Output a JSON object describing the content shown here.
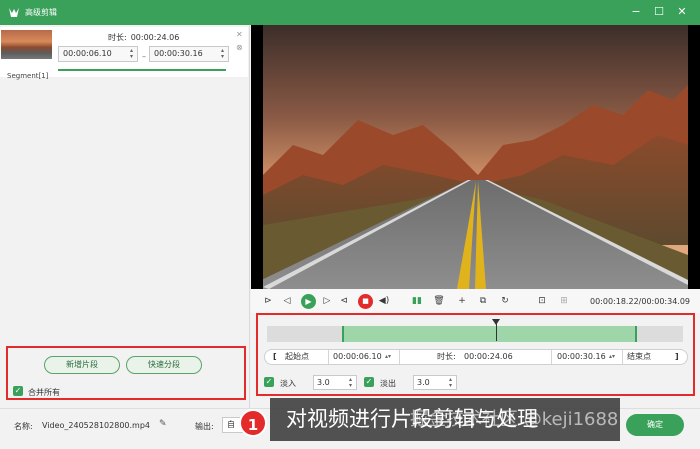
{
  "window": {
    "title": "高级剪辑",
    "controls": {
      "minimize": "−",
      "maximize": "☐",
      "close": "✕"
    }
  },
  "segments": [
    {
      "label": "Segment[1]",
      "duration_label": "时长:",
      "duration": "00:00:24.06",
      "start": "00:00:06.10",
      "end": "00:00:30.16",
      "separator": "–"
    }
  ],
  "left_actions": {
    "new_segment": "新增片段",
    "quick_split": "快速分段",
    "merge_all": "合并所有",
    "merge_checked": true
  },
  "player": {
    "time_current": "00:00:18.22",
    "time_total": "00:00:34.09",
    "time_separator": "/"
  },
  "timeline": {
    "selection_start": 0.18,
    "selection_end": 0.89,
    "playhead": 0.55
  },
  "range": {
    "start_label": "起始点",
    "start_value": "00:00:06.10",
    "duration_label": "时长:",
    "duration_value": "00:00:24.06",
    "end_value": "00:00:30.16",
    "end_label": "结束点",
    "left_bracket": "[",
    "right_bracket": "]"
  },
  "fade": {
    "fade_in_label": "淡入",
    "fade_in_value": "3.0",
    "fade_in_checked": true,
    "fade_out_label": "淡出",
    "fade_out_value": "3.0",
    "fade_out_checked": true
  },
  "bottom": {
    "name_label": "名称:",
    "file_name": "Video_240528102800.mp4",
    "output_label": "输出:",
    "output_value": "自",
    "ok_button": "确定"
  },
  "overlay": {
    "badge": "1",
    "caption": "对视频进行片段剪辑与处理",
    "watermark": "掘金技术社区 @keji1688"
  },
  "colors": {
    "accent": "#3aa15a",
    "highlight": "#e32b2b",
    "selection": "#9fd6a9"
  }
}
